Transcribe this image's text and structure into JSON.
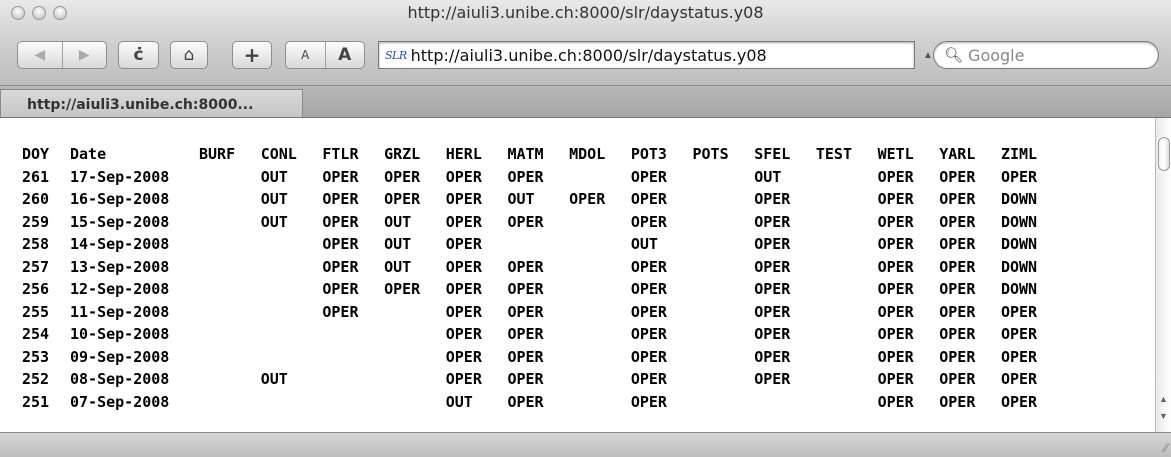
{
  "window": {
    "title": "http://aiuli3.unibe.ch:8000/slr/daystatus.y08"
  },
  "toolbar": {
    "back_icon": "back-arrow-icon",
    "forward_icon": "forward-arrow-icon",
    "reload_glyph": "ċ",
    "home_glyph": "⌂",
    "add_glyph": "+",
    "font_small": "A",
    "font_large": "A",
    "site_icon_text": "SLR",
    "url": "http://aiuli3.unibe.ch:8000/slr/daystatus.y08",
    "search_placeholder": "Google"
  },
  "tab": {
    "label": "http://aiuli3.unibe.ch:8000..."
  },
  "table": {
    "headers": [
      "DOY",
      "Date",
      "BURF",
      "CONL",
      "FTLR",
      "GRZL",
      "HERL",
      "MATM",
      "MDOL",
      "POT3",
      "POTS",
      "SFEL",
      "TEST",
      "WETL",
      "YARL",
      "ZIML"
    ],
    "rows": [
      [
        "261",
        "17-Sep-2008",
        "",
        "OUT",
        "OPER",
        "OPER",
        "OPER",
        "OPER",
        "",
        "OPER",
        "",
        "OUT",
        "",
        "OPER",
        "OPER",
        "OPER"
      ],
      [
        "260",
        "16-Sep-2008",
        "",
        "OUT",
        "OPER",
        "OPER",
        "OPER",
        "OUT",
        "OPER",
        "OPER",
        "",
        "OPER",
        "",
        "OPER",
        "OPER",
        "DOWN"
      ],
      [
        "259",
        "15-Sep-2008",
        "",
        "OUT",
        "OPER",
        "OUT",
        "OPER",
        "OPER",
        "",
        "OPER",
        "",
        "OPER",
        "",
        "OPER",
        "OPER",
        "DOWN"
      ],
      [
        "258",
        "14-Sep-2008",
        "",
        "",
        "OPER",
        "OUT",
        "OPER",
        "",
        "",
        "OUT",
        "",
        "OPER",
        "",
        "OPER",
        "OPER",
        "DOWN"
      ],
      [
        "257",
        "13-Sep-2008",
        "",
        "",
        "OPER",
        "OUT",
        "OPER",
        "OPER",
        "",
        "OPER",
        "",
        "OPER",
        "",
        "OPER",
        "OPER",
        "DOWN"
      ],
      [
        "256",
        "12-Sep-2008",
        "",
        "",
        "OPER",
        "OPER",
        "OPER",
        "OPER",
        "",
        "OPER",
        "",
        "OPER",
        "",
        "OPER",
        "OPER",
        "DOWN"
      ],
      [
        "255",
        "11-Sep-2008",
        "",
        "",
        "OPER",
        "",
        "OPER",
        "OPER",
        "",
        "OPER",
        "",
        "OPER",
        "",
        "OPER",
        "OPER",
        "OPER"
      ],
      [
        "254",
        "10-Sep-2008",
        "",
        "",
        "",
        "",
        "OPER",
        "OPER",
        "",
        "OPER",
        "",
        "OPER",
        "",
        "OPER",
        "OPER",
        "OPER"
      ],
      [
        "253",
        "09-Sep-2008",
        "",
        "",
        "",
        "",
        "OPER",
        "OPER",
        "",
        "OPER",
        "",
        "OPER",
        "",
        "OPER",
        "OPER",
        "OPER"
      ],
      [
        "252",
        "08-Sep-2008",
        "",
        "OUT",
        "",
        "",
        "OPER",
        "OPER",
        "",
        "OPER",
        "",
        "OPER",
        "",
        "OPER",
        "OPER",
        "OPER"
      ],
      [
        "251",
        "07-Sep-2008",
        "",
        "",
        "",
        "",
        "OUT",
        "OPER",
        "",
        "OPER",
        "",
        "",
        "",
        "OPER",
        "OPER",
        "OPER"
      ]
    ]
  }
}
